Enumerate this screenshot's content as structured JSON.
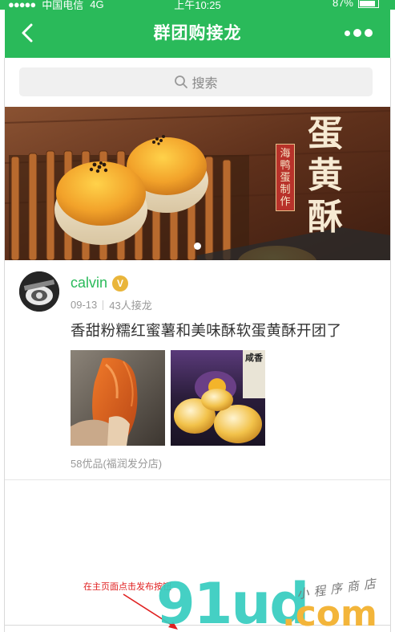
{
  "status_bar": {
    "signal": "●●●●●",
    "carrier": "中国电信",
    "network": "4G",
    "time": "上午10:25",
    "battery": "87%"
  },
  "nav": {
    "title": "群团购接龙",
    "back_icon": "chevron-left-icon",
    "more_icon": "more-dots-icon"
  },
  "search": {
    "placeholder": "搜索",
    "icon": "search-icon"
  },
  "banner": {
    "tag_text": "海鸭蛋制作",
    "big_text": [
      "蛋",
      "黄",
      "酥"
    ],
    "slide_count": 1,
    "active_slide": 1
  },
  "post": {
    "author": "calvin",
    "badge": "V",
    "date": "09-13",
    "participants": "43人接龙",
    "title": "香甜粉糯红蜜薯和美味酥软蛋黄酥开团了",
    "shop": "58优品(福润发分店)",
    "thumb2_label": "咸香"
  },
  "annotation": {
    "text": "在主页面点击发布按钮"
  },
  "watermark": {
    "main": "91ud",
    "com": ".com",
    "sub": "小程序商店"
  },
  "colors": {
    "brand_green": "#2aba5a",
    "badge_gold": "#e9b53a",
    "annotation_red": "#e02020"
  }
}
